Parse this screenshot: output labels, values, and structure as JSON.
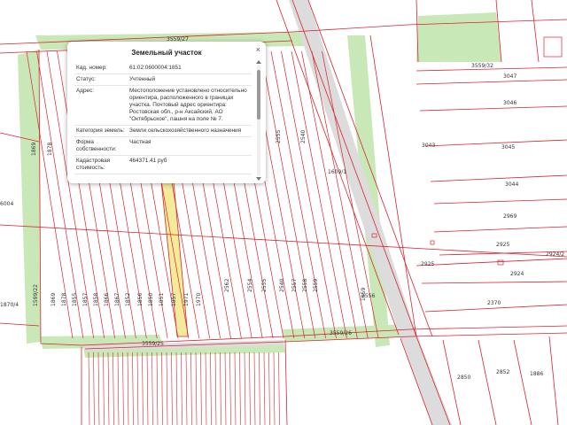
{
  "popup": {
    "title": "Земельный участок",
    "close_glyph": "×",
    "rows": [
      {
        "key": "Кад. номер:",
        "value": "61:02:0600004:1851"
      },
      {
        "key": "Статус:",
        "value": "Учтенный"
      },
      {
        "key": "Адрес:",
        "value": "Местоположение установлено относительно ориентира, расположенного в границах участка. Почтовый адрес ориентира: Ростовская обл., р-н Аксайский, АО \"Октябрьское\", пашня на поле № 7."
      },
      {
        "key": "Категория земель:",
        "value": "Земли сельскохозяйственного назначения"
      },
      {
        "key": "Форма собственности:",
        "value": "Частная"
      },
      {
        "key": "Кадастровая стоимость:",
        "value": "464371.41 руб"
      }
    ]
  },
  "map_labels": {
    "road_top": "3559/27",
    "road_right": "3559/32",
    "road_mid": "3559/26",
    "road_bottom": "3559/25",
    "parcel_1609": "1609/1",
    "parcel_2556": "2556",
    "parcel_2969": "2969",
    "parcel_2925": "2925",
    "parcel_2924": "2924",
    "parcel_2924_2": "2924/2",
    "parcel_2370": "2370",
    "parcel_3047": "3047",
    "parcel_3046": "3046",
    "parcel_3045": "3045",
    "parcel_3044": "3044",
    "parcel_3043": "3043",
    "parcel_2850": "2850",
    "parcel_2852": "2852",
    "parcel_1886": "1886",
    "parcel_6004": "6004",
    "parcel_1870": "1870/4",
    "parcel_1599": "1599/22",
    "selected_parcel": "1851",
    "strip_numbers": [
      "1869",
      "1878",
      "1855",
      "1857",
      "1858",
      "1866",
      "1867",
      "1852",
      "1856",
      "1850",
      "1851",
      "1857",
      "1971",
      "1970",
      "2562",
      "2554",
      "2555",
      "2540",
      "2557",
      "2558",
      "2559",
      "1959"
    ]
  },
  "colors": {
    "boundary": "#d9232e",
    "green": "#c9e8b8",
    "highlight": "#f3ea9a",
    "road": "#d8d8d8"
  }
}
